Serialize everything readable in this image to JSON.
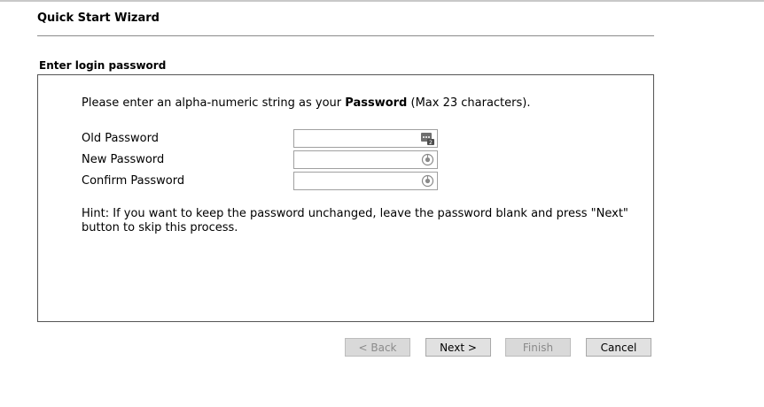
{
  "wizard": {
    "title": "Quick Start Wizard",
    "section_title": "Enter login password"
  },
  "intro": {
    "prefix": "Please enter an alpha-numeric string as your ",
    "bold": "Password",
    "suffix": " (Max 23 characters)."
  },
  "fields": [
    {
      "label": "Old Password",
      "value": "",
      "icon": "password-manager-icon"
    },
    {
      "label": "New Password",
      "value": "",
      "icon": "password-reveal-icon"
    },
    {
      "label": "Confirm Password",
      "value": "",
      "icon": "password-reveal-icon"
    }
  ],
  "hint": "Hint: If you want to keep the password unchanged, leave the password blank and press \"Next\" button to skip this process.",
  "buttons": {
    "back": "< Back",
    "next": "Next >",
    "finish": "Finish",
    "cancel": "Cancel"
  }
}
